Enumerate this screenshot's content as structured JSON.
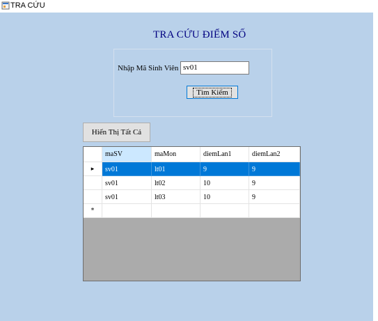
{
  "window": {
    "title": "TRA CỨU"
  },
  "form": {
    "heading": "TRA CỨU ĐIỂM  SỐ",
    "label": "Nhập Mã Sinh Viên",
    "input_value": "sv01",
    "search_button": "Tìm Kiếm",
    "show_all_button": "Hiển Thị Tất Cả"
  },
  "grid": {
    "columns": [
      "maSV",
      "maMon",
      "diemLan1",
      "diemLan2"
    ],
    "rows": [
      [
        "sv01",
        "lt01",
        "9",
        "9"
      ],
      [
        "sv01",
        "lt02",
        "10",
        "9"
      ],
      [
        "sv01",
        "lt03",
        "10",
        "9"
      ]
    ],
    "current_marker": "▸",
    "new_row_marker": "*"
  },
  "colors": {
    "client": "#b9d1ea",
    "selection": "#0078d7",
    "heading": "#000080"
  }
}
